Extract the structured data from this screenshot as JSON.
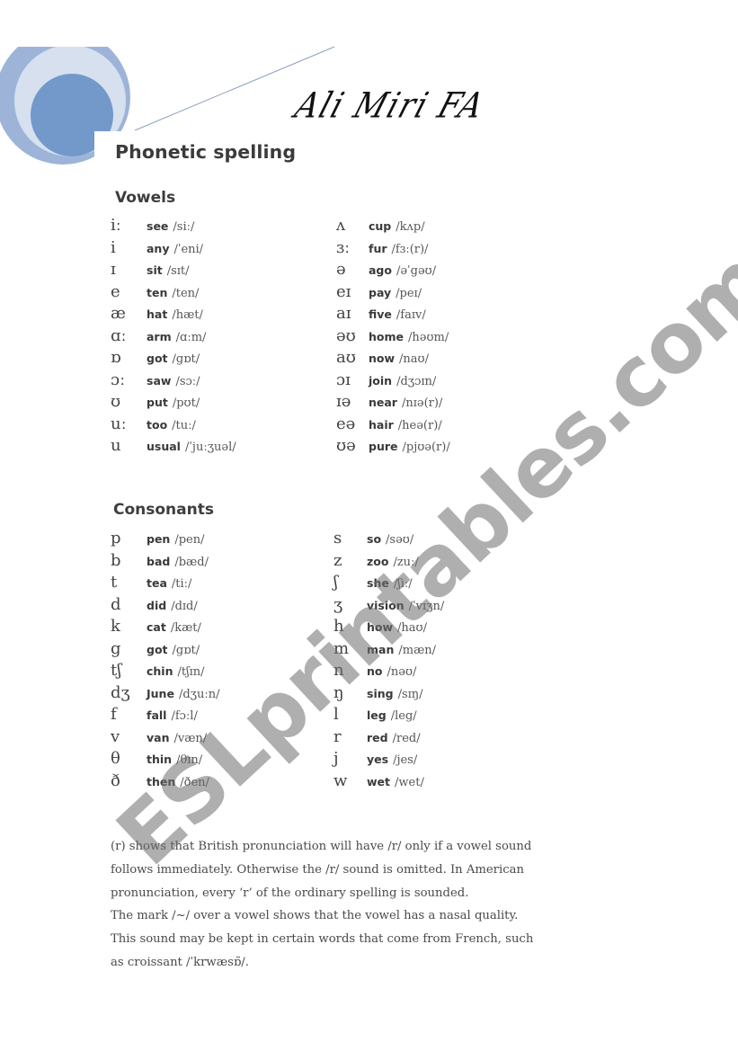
{
  "header": {
    "signature": "Ali Miri FA",
    "title": "Phonetic spelling"
  },
  "vowels": {
    "title": "Vowels",
    "left": [
      {
        "symbol": "iː",
        "word": "see",
        "ipa": "/siː/"
      },
      {
        "symbol": "i",
        "word": "any",
        "ipa": "/ˈeni/"
      },
      {
        "symbol": "ɪ",
        "word": "sit",
        "ipa": "/sɪt/"
      },
      {
        "symbol": "e",
        "word": "ten",
        "ipa": "/ten/"
      },
      {
        "symbol": "æ",
        "word": "hat",
        "ipa": "/hæt/"
      },
      {
        "symbol": "ɑː",
        "word": "arm",
        "ipa": "/ɑːm/"
      },
      {
        "symbol": "ɒ",
        "word": "got",
        "ipa": "/gɒt/"
      },
      {
        "symbol": "ɔː",
        "word": "saw",
        "ipa": "/sɔː/"
      },
      {
        "symbol": "ʊ",
        "word": "put",
        "ipa": "/pʊt/"
      },
      {
        "symbol": "uː",
        "word": "too",
        "ipa": "/tuː/"
      },
      {
        "symbol": "u",
        "word": "usual",
        "ipa": "/ˈjuːʒuəl/"
      }
    ],
    "right": [
      {
        "symbol": "ʌ",
        "word": "cup",
        "ipa": "/kʌp/"
      },
      {
        "symbol": "ɜː",
        "word": "fur",
        "ipa": "/fɜː(r)/"
      },
      {
        "symbol": "ə",
        "word": "ago",
        "ipa": "/əˈgəʊ/"
      },
      {
        "symbol": "eɪ",
        "word": "pay",
        "ipa": "/peɪ/"
      },
      {
        "symbol": "aɪ",
        "word": "five",
        "ipa": "/faɪv/"
      },
      {
        "symbol": "əʊ",
        "word": "home",
        "ipa": "/həʊm/"
      },
      {
        "symbol": "aʊ",
        "word": "now",
        "ipa": "/naʊ/"
      },
      {
        "symbol": "ɔɪ",
        "word": "join",
        "ipa": "/dʒɔɪn/"
      },
      {
        "symbol": "ɪə",
        "word": "near",
        "ipa": "/nɪə(r)/"
      },
      {
        "symbol": "eə",
        "word": "hair",
        "ipa": "/heə(r)/"
      },
      {
        "symbol": "ʊə",
        "word": "pure",
        "ipa": "/pjʊə(r)/"
      }
    ]
  },
  "consonants": {
    "title": "Consonants",
    "left": [
      {
        "symbol": "p",
        "word": "pen",
        "ipa": "/pen/"
      },
      {
        "symbol": "b",
        "word": "bad",
        "ipa": "/bæd/"
      },
      {
        "symbol": "t",
        "word": "tea",
        "ipa": "/tiː/"
      },
      {
        "symbol": "d",
        "word": "did",
        "ipa": "/dɪd/"
      },
      {
        "symbol": "k",
        "word": "cat",
        "ipa": "/kæt/"
      },
      {
        "symbol": "g",
        "word": "got",
        "ipa": "/gɒt/"
      },
      {
        "symbol": "tʃ",
        "word": "chin",
        "ipa": "/tʃɪn/"
      },
      {
        "symbol": "dʒ",
        "word": "June",
        "ipa": "/dʒuːn/"
      },
      {
        "symbol": "f",
        "word": "fall",
        "ipa": "/fɔːl/"
      },
      {
        "symbol": "v",
        "word": "van",
        "ipa": "/væn/"
      },
      {
        "symbol": "θ",
        "word": "thin",
        "ipa": "/θɪn/"
      },
      {
        "symbol": "ð",
        "word": "then",
        "ipa": "/ðen/"
      }
    ],
    "right": [
      {
        "symbol": "s",
        "word": "so",
        "ipa": "/səʊ/"
      },
      {
        "symbol": "z",
        "word": "zoo",
        "ipa": "/zuː/"
      },
      {
        "symbol": "ʃ",
        "word": "she",
        "ipa": "/ʃiː/"
      },
      {
        "symbol": "ʒ",
        "word": "vision",
        "ipa": "/ˈvɪʒn/"
      },
      {
        "symbol": "h",
        "word": "how",
        "ipa": "/haʊ/"
      },
      {
        "symbol": "m",
        "word": "man",
        "ipa": "/mæn/"
      },
      {
        "symbol": "n",
        "word": "no",
        "ipa": "/nəʊ/"
      },
      {
        "symbol": "ŋ",
        "word": "sing",
        "ipa": "/sɪŋ/"
      },
      {
        "symbol": "l",
        "word": "leg",
        "ipa": "/leg/"
      },
      {
        "symbol": "r",
        "word": "red",
        "ipa": "/red/"
      },
      {
        "symbol": "j",
        "word": "yes",
        "ipa": "/jes/"
      },
      {
        "symbol": "w",
        "word": "wet",
        "ipa": "/wet/"
      }
    ]
  },
  "notes": [
    "(r) shows that British pronunciation will have /r/ only if a vowel sound follows immediately.  Otherwise the /r/ sound is omitted. In American pronunciation, every ‘r’ of the ordinary spelling is sounded.",
    "The mark /~/ over a vowel shows that the vowel has a nasal quality. This sound may be kept in certain words that come from French, such as croissant /ˈkrwæsɒ̃/."
  ],
  "watermark": "ESLprintables.com",
  "colors": {
    "circle_outer": "#9db4d8",
    "circle_mid": "#d6e0ef",
    "circle_inner": "#7399cb",
    "rule_line": "#8c9fbf"
  }
}
